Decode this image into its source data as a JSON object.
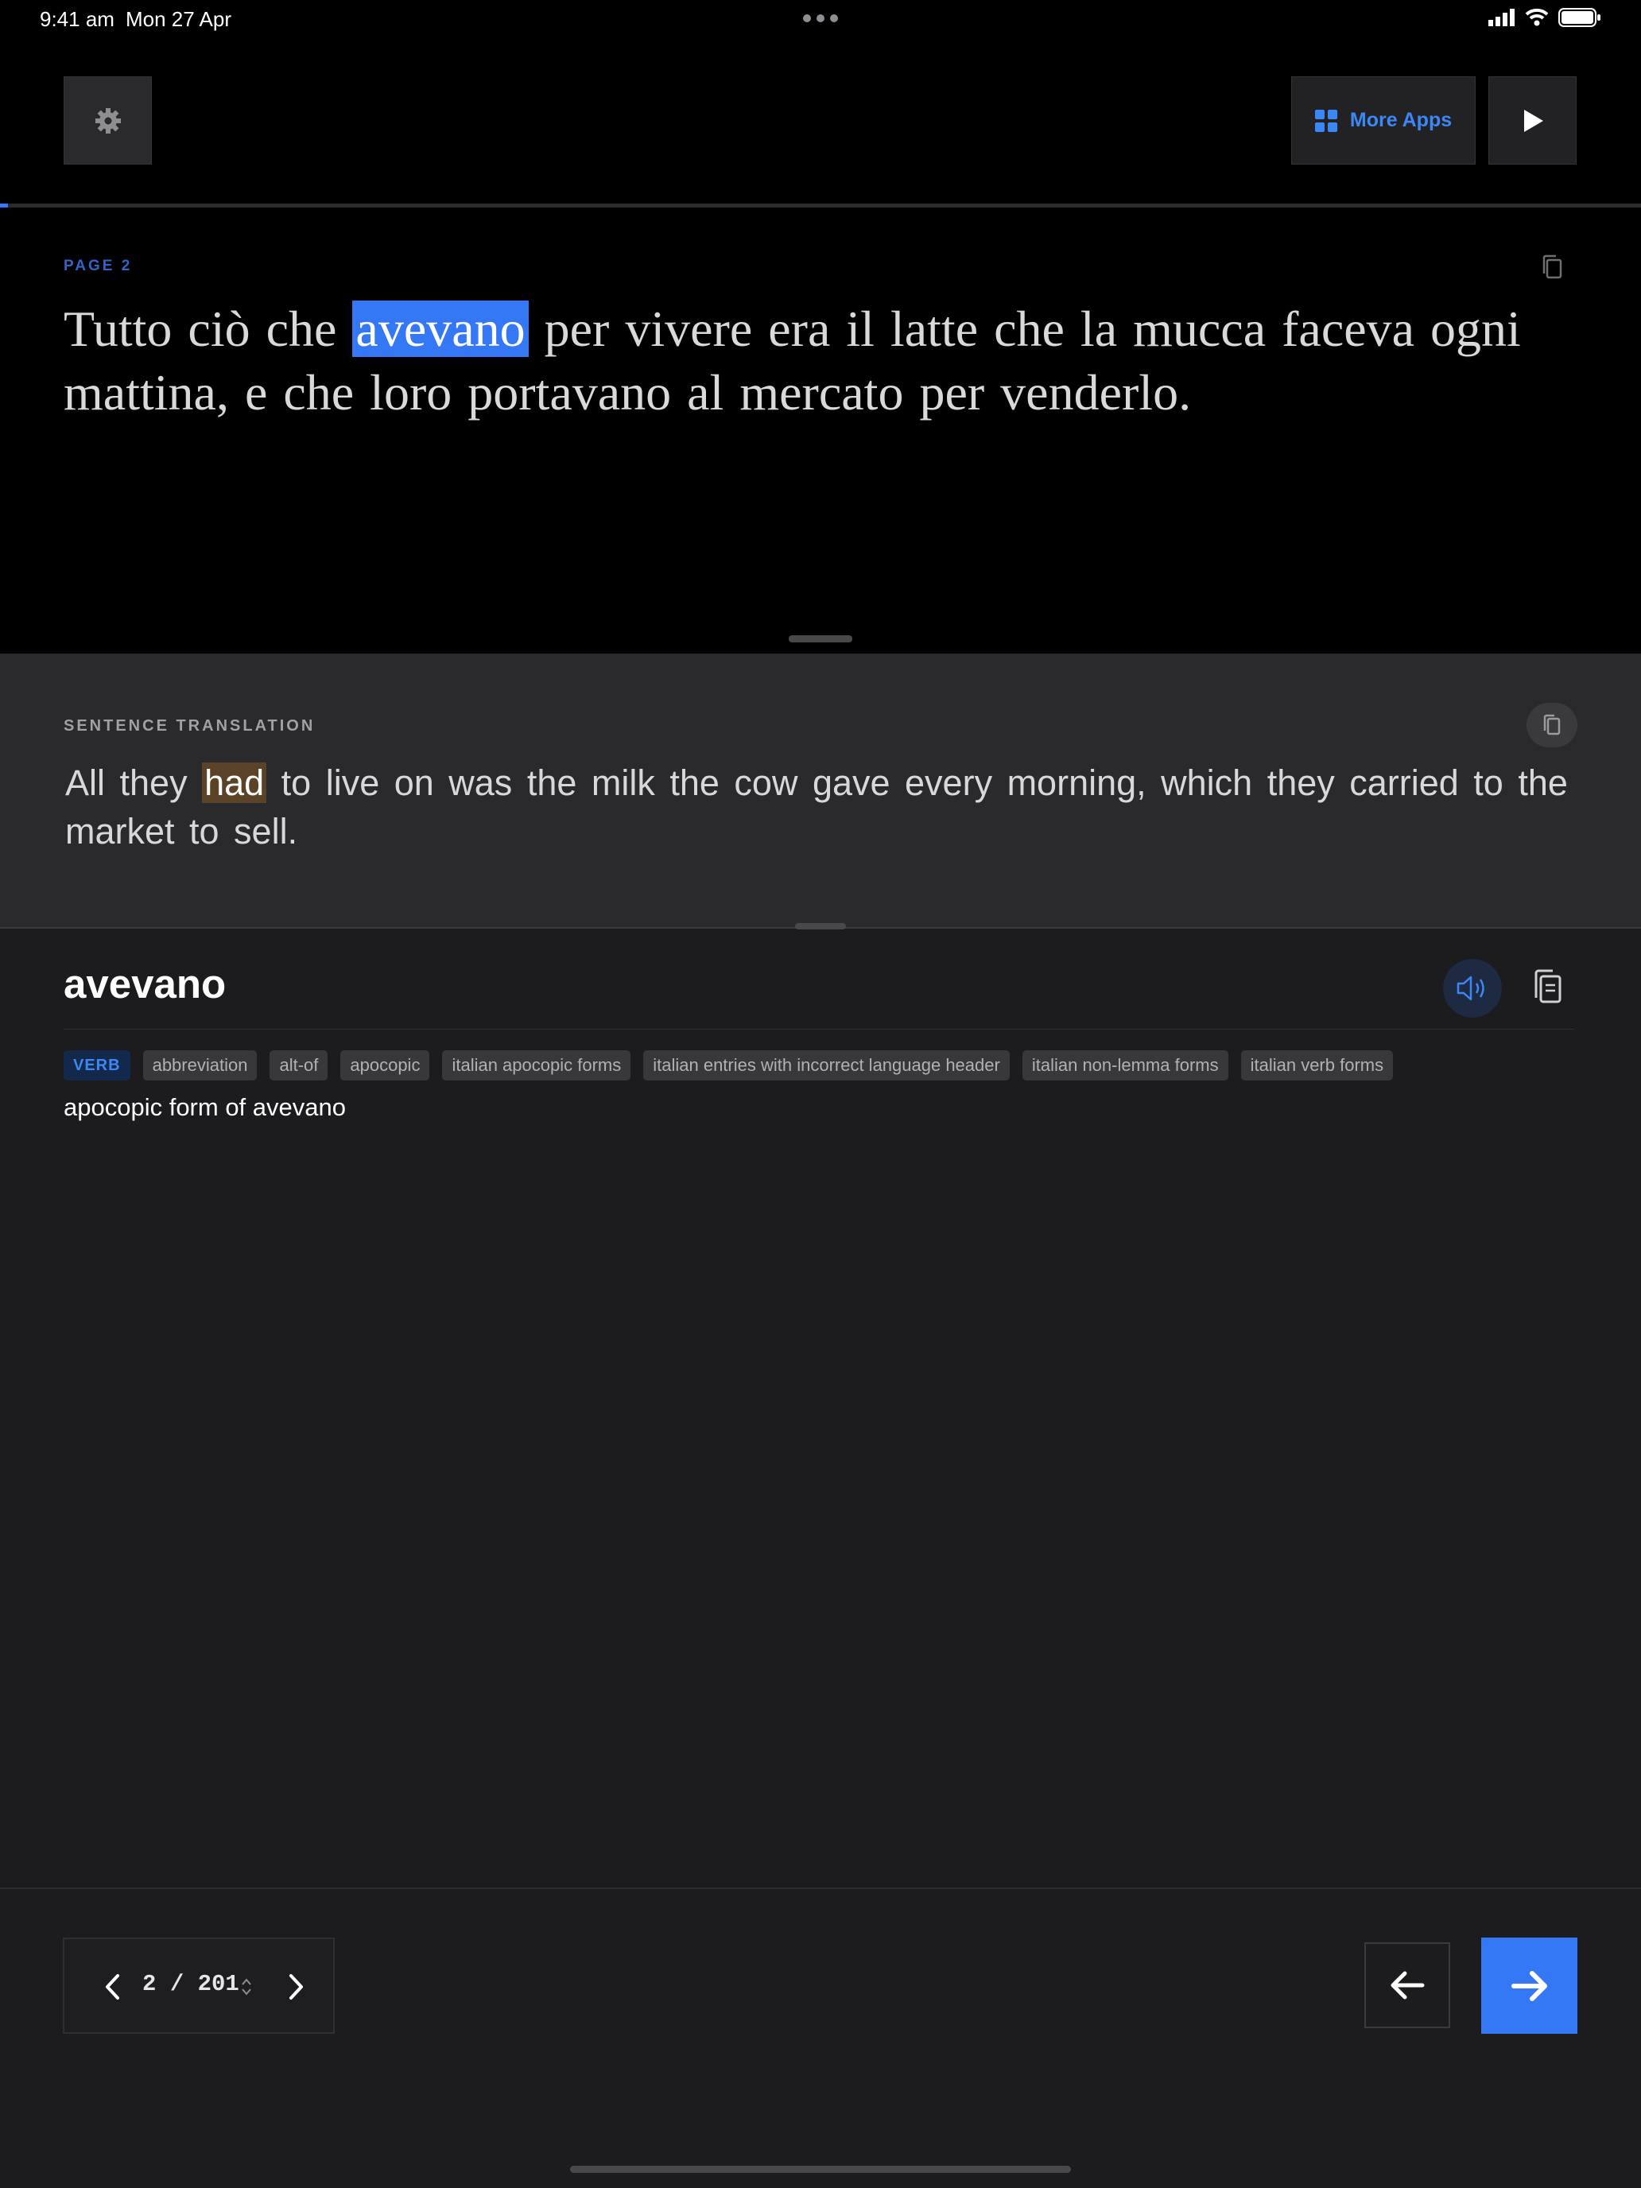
{
  "status_bar": {
    "time": "9:41 am",
    "date": "Mon 27 Apr"
  },
  "toolbar": {
    "more_apps_label": "More Apps"
  },
  "reader": {
    "progress": 0.005,
    "page_label": "PAGE 2",
    "passage_before": "Tutto ciò che ",
    "passage_highlight": "avevano",
    "passage_after": " per vivere era il latte che la mucca faceva ogni mattina, e che loro portavano al mercato per venderlo."
  },
  "translation": {
    "label": "SENTENCE TRANSLATION",
    "text_before": "All they ",
    "text_highlight": "had",
    "text_after": " to live on was the milk the cow gave every morning, which they carried to the market to sell."
  },
  "dictionary": {
    "word": "avevano",
    "part_of_speech": "VERB",
    "tags": [
      "abbreviation",
      "alt-of",
      "apocopic",
      "italian apocopic forms",
      "italian entries with incorrect language header",
      "italian non-lemma forms",
      "italian verb forms"
    ],
    "definition": "apocopic form of avevano"
  },
  "pager": {
    "current": "2",
    "separator": "/",
    "total": "201"
  },
  "colors": {
    "accent": "#3478f6",
    "translation_highlight": "#5a4326",
    "background": "#1c1c1e"
  },
  "icons": [
    "gear-icon",
    "grid-icon",
    "play-icon",
    "copy-icon",
    "speaker-icon",
    "chevron-left-icon",
    "chevron-right-icon",
    "updown-icon",
    "arrow-left-icon",
    "arrow-right-icon"
  ]
}
